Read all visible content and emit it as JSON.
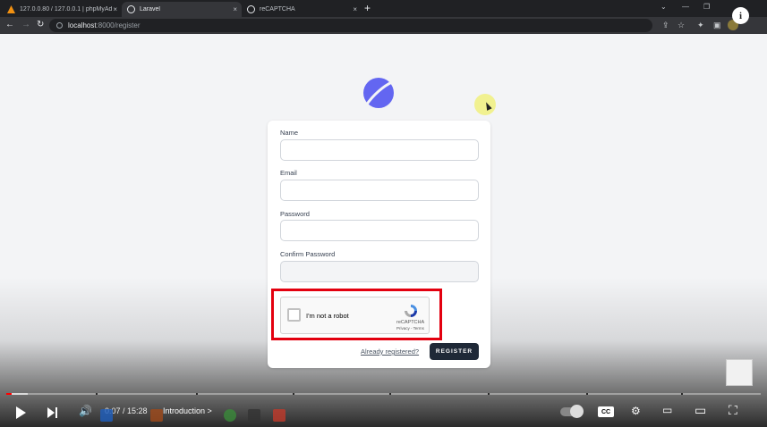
{
  "browser": {
    "tabs": [
      {
        "label": "127.0.0.80 / 127.0.0.1 | phpMyAd",
        "close": "×"
      },
      {
        "label": "Laravel",
        "close": "×"
      },
      {
        "label": "reCAPTCHA",
        "close": "×"
      }
    ],
    "new_tab": "+",
    "address": {
      "host": "localhost",
      "path": ":8000/register"
    }
  },
  "form": {
    "name_label": "Name",
    "email_label": "Email",
    "password_label": "Password",
    "confirm_label": "Confirm Password",
    "already_registered": "Already registered?",
    "register_button": "REGISTER"
  },
  "recaptcha": {
    "checkbox_label": "I'm not a robot",
    "brand": "reCAPTCHA",
    "links": "Privacy - Terms"
  },
  "player": {
    "time": "0:07 / 15:28",
    "chapter": "Introduction",
    "chapter_chevron": ">",
    "cc": "CC",
    "info": "i",
    "progress_played_fraction": 0.0075,
    "progress_loaded_fraction": 0.028
  },
  "colors": {
    "accent": "#1f2937",
    "highlight": "#e3000f",
    "logo": "#6366f1",
    "progress": "#ff0000"
  }
}
